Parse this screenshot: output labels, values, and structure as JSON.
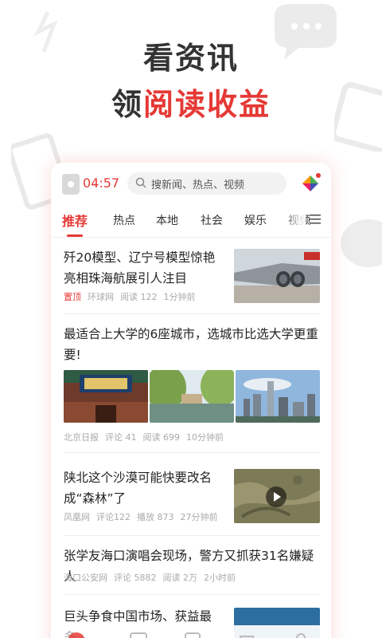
{
  "promo": {
    "line1": "看资讯",
    "line2_prefix": "领",
    "line2_accent": "阅读收益"
  },
  "app": {
    "time": "04:57",
    "search_placeholder": "搜新闻、热点、视频",
    "accent_color": "#e53935"
  },
  "tabs": [
    {
      "label": "推荐",
      "active": true
    },
    {
      "label": "热点"
    },
    {
      "label": "本地"
    },
    {
      "label": "社会"
    },
    {
      "label": "娱乐"
    },
    {
      "label": "视频"
    }
  ],
  "articles": [
    {
      "title": "歼20模型、辽宁号模型惊艳亮相珠海航展引人注目",
      "meta": [
        "置顶",
        "环球网",
        "阅读 122",
        "1分钟前"
      ]
    },
    {
      "title": "最适合上大学的6座城市，选城市比选大学更重要!",
      "meta": [
        "北京日报",
        "评论 41",
        "阅读 699",
        "10分钟前"
      ]
    },
    {
      "title": "陕北这个沙漠可能快要改名成“森林”了",
      "meta": [
        "凤凰网",
        "评论122",
        "播放 873",
        "27分钟前"
      ]
    },
    {
      "title": "张学友海口演唱会现场，警方又抓获31名嫌疑人",
      "meta": [
        "海口公安网",
        "评论 5882",
        "阅读 2万",
        "2小时前"
      ]
    },
    {
      "title": "巨头争食中国市场、获益最多"
    }
  ],
  "icons": [
    "search-icon",
    "app-logo-icon",
    "menu-icon",
    "play-icon"
  ]
}
